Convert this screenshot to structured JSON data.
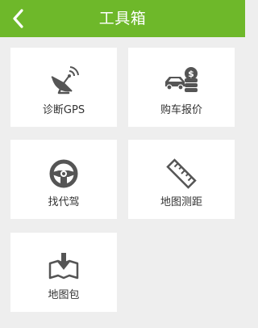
{
  "header": {
    "title": "工具箱",
    "back_icon": "chevron-left-icon",
    "color": "#6eb82a"
  },
  "tools": [
    {
      "label": "诊断GPS",
      "icon": "satellite-dish-icon"
    },
    {
      "label": "购车报价",
      "icon": "car-price-icon"
    },
    {
      "label": "找代驾",
      "icon": "steering-wheel-icon"
    },
    {
      "label": "地图测距",
      "icon": "ruler-icon"
    },
    {
      "label": "地图包",
      "icon": "map-download-icon"
    }
  ],
  "colors": {
    "background": "#eeeeee",
    "tile": "#ffffff",
    "icon": "#555555",
    "text": "#333333"
  }
}
